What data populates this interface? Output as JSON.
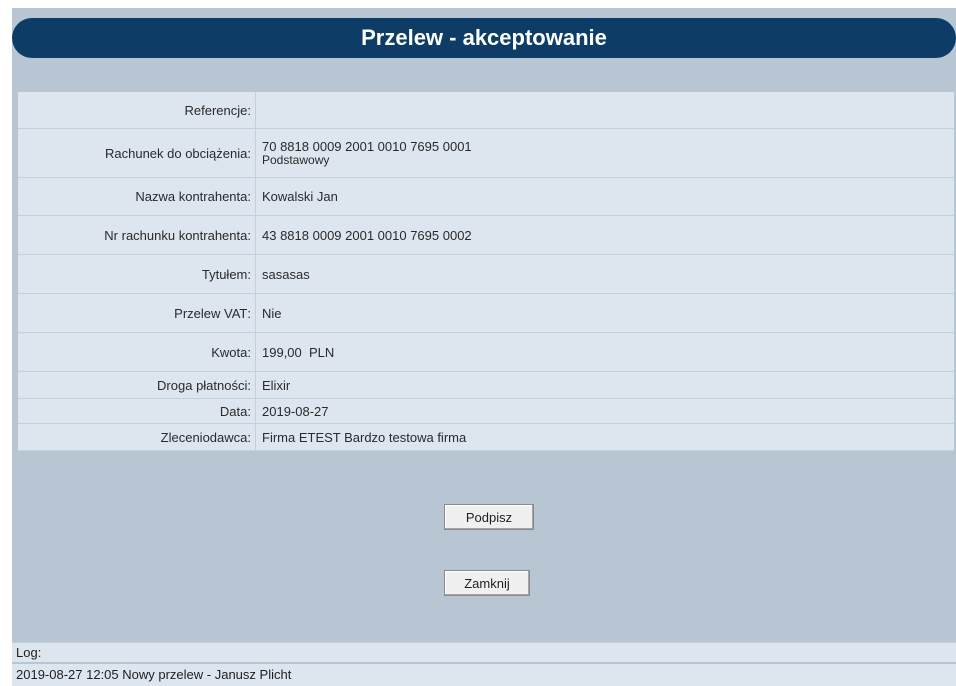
{
  "title": "Przelew - akceptowanie",
  "details": [
    {
      "label": "Referencje",
      "value": ""
    },
    {
      "label": "Rachunek do obciążenia",
      "value": "70 8818 0009 2001 0010 7695 0001",
      "sub": "Podstawowy"
    },
    {
      "label": "Nazwa kontrahenta",
      "value": "Kowalski Jan"
    },
    {
      "label": "Nr rachunku kontrahenta",
      "value": "43 8818 0009 2001 0010 7695 0002"
    },
    {
      "label": "Tytułem",
      "value": "sasasas"
    },
    {
      "label": "Przelew VAT",
      "value": "Nie"
    },
    {
      "label": "Kwota",
      "value": "199,00  PLN"
    },
    {
      "label": "Droga płatności",
      "value": "Elixir"
    },
    {
      "label": "Data",
      "value": "2019-08-27"
    },
    {
      "label": "Zleceniodawca",
      "value": "Firma ETEST Bardzo testowa firma"
    }
  ],
  "buttons": {
    "sign": "Podpisz",
    "close": "Zamknij"
  },
  "log": {
    "header": "Log:",
    "entries": [
      "2019-08-27 12:05 Nowy przelew - Janusz Plicht"
    ]
  },
  "colors": {
    "title_bar": "#0d3d66",
    "panel": "#b7c6d2",
    "row": "#dde5ef"
  }
}
